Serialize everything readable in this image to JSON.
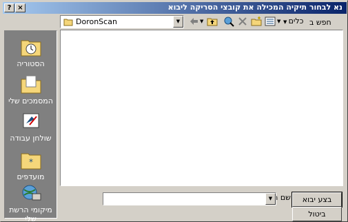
{
  "window": {
    "title": "נא לבחור תיקיה המכילה את קובצי הסריקה ליבוא",
    "help_glyph": "?",
    "close_glyph": "×"
  },
  "toolbar": {
    "look_in_label": "חפש ב",
    "look_in_value": "DoronScan",
    "tools_label": "כלים",
    "icons": [
      "back-icon",
      "up-folder-icon",
      "search-web-icon",
      "delete-icon",
      "new-folder-icon",
      "views-icon"
    ]
  },
  "places": [
    {
      "label": "הסטוריה",
      "icon": "history-icon"
    },
    {
      "label": "המסמכים שלי",
      "icon": "my-documents-icon"
    },
    {
      "label": "שולחן עבודה",
      "icon": "desktop-icon"
    },
    {
      "label": "מועדפים",
      "icon": "favorites-icon"
    },
    {
      "label": "מיקומי הרשת שלי",
      "icon": "network-places-icon"
    }
  ],
  "folder_name": {
    "label": "שם התיקיה",
    "value": ""
  },
  "buttons": {
    "ok": "בצע יבוא",
    "cancel": "ביטול"
  }
}
